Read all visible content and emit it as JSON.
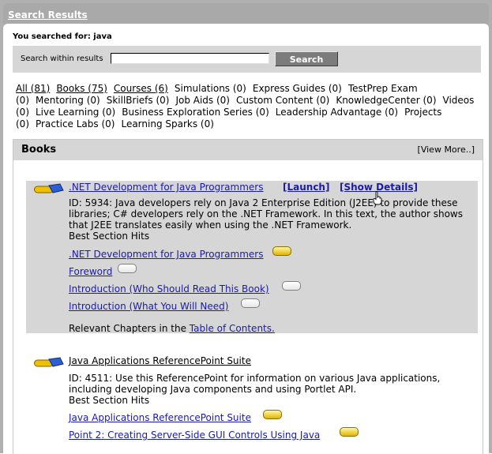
{
  "window": {
    "title": "Search Results"
  },
  "search": {
    "query_label": "You searched for: java",
    "within_label": "Search within results",
    "within_value": "",
    "button_label": "Search"
  },
  "facets": [
    {
      "label": "All (81)",
      "link": true
    },
    {
      "label": "Books (75)",
      "link": true
    },
    {
      "label": "Courses (6)",
      "link": true
    },
    {
      "label": "Simulations (0)",
      "link": false
    },
    {
      "label": "Express Guides (0)",
      "link": false
    },
    {
      "label": "TestPrep Exam (0)",
      "link": false
    },
    {
      "label": "Mentoring (0)",
      "link": false
    },
    {
      "label": "SkillBriefs (0)",
      "link": false
    },
    {
      "label": "Job Aids (0)",
      "link": false
    },
    {
      "label": "Custom Content (0)",
      "link": false
    },
    {
      "label": "KnowledgeCenter (0)",
      "link": false
    },
    {
      "label": "Videos (0)",
      "link": false
    },
    {
      "label": "Live Learning (0)",
      "link": false
    },
    {
      "label": "Business Exploration Series (0)",
      "link": false
    },
    {
      "label": "Leadership Advantage (0)",
      "link": false
    },
    {
      "label": "Projects (0)",
      "link": false
    },
    {
      "label": "Practice Labs (0)",
      "link": false
    },
    {
      "label": "Learning Sparks (0)",
      "link": false
    }
  ],
  "books": {
    "header": "Books",
    "view_more": "[View More..]",
    "results": [
      {
        "title": ".NET Development for Java Programmers",
        "launch": "[Launch]",
        "details": "[Show Details]",
        "description": "ID: 5934: Java developers rely on Java 2 Enterprise Edition (J2EE) to provide these libraries; C# developers rely on the .NET Framework. In this text, the author shows that J2EE translates easily when using the .NET Framework.",
        "best_hits_label": "Best Section Hits",
        "hits": [
          {
            "label": ".NET Development for Java Programmers",
            "icon": "full"
          },
          {
            "label": "Foreword",
            "icon": "empty"
          },
          {
            "label": "Introduction (Who Should Read This Book)",
            "icon": "empty"
          },
          {
            "label": "Introduction (What You Will Need)",
            "icon": "empty"
          }
        ],
        "chapters_prefix": "Relevant Chapters in the ",
        "chapters_link": "Table of Contents."
      },
      {
        "title": "Java Applications ReferencePoint Suite",
        "description": "ID: 4511: Use this ReferencePoint for information on various Java applications, including developing Java components and using Portlet API.",
        "best_hits_label": "Best Section Hits",
        "hits": [
          {
            "label": "Java Applications ReferencePoint Suite",
            "icon": "full"
          },
          {
            "label": "Point 2: Creating Server-Side GUI Controls Using Java",
            "icon": "full"
          }
        ]
      }
    ]
  }
}
